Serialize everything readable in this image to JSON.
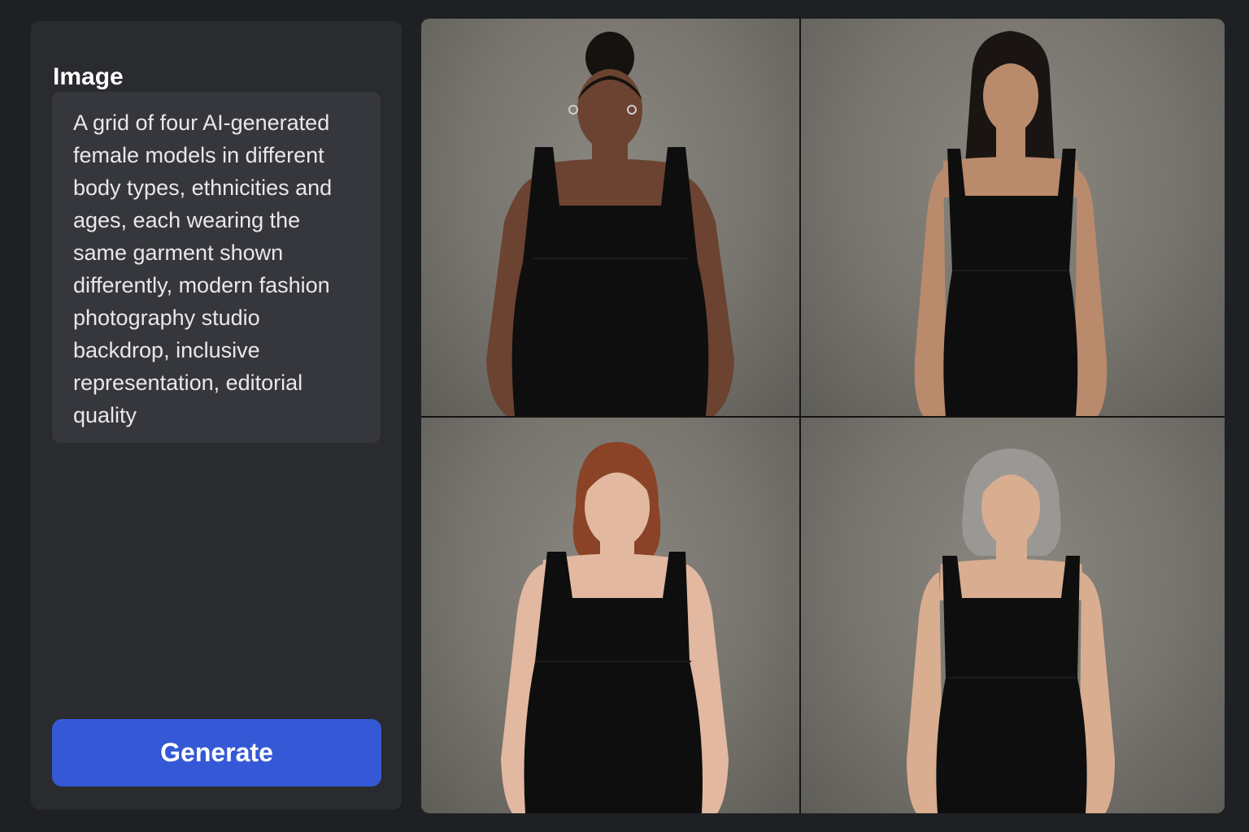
{
  "sidebar": {
    "title": "Image",
    "prompt_text": "A grid of four AI-generated\nfemale models in different\nbody types, ethnicities and\nages, each wearing the\nsame garment shown\ndifferently, modern fashion\nphotography studio\nbackdrop, inclusive\nrepresentation, editorial\nquality",
    "generate_label": "Generate"
  },
  "colors": {
    "accent": "#3559d6",
    "background": "#1f2023",
    "panel": "#2a2b2f",
    "prompt_box": "#36373c"
  },
  "grid": {
    "images": [
      {
        "name": "model-photo-1",
        "skin": "#6b4330",
        "hair": "#151210",
        "hair_style": "bun"
      },
      {
        "name": "model-photo-2",
        "skin": "#b98a6c",
        "hair": "#1a1512",
        "hair_style": "long"
      },
      {
        "name": "model-photo-3",
        "skin": "#e2b8a0",
        "hair": "#8a4326",
        "hair_style": "bob"
      },
      {
        "name": "model-photo-4",
        "skin": "#d8ad90",
        "hair": "#9a9894",
        "hair_style": "shoulder"
      }
    ]
  }
}
